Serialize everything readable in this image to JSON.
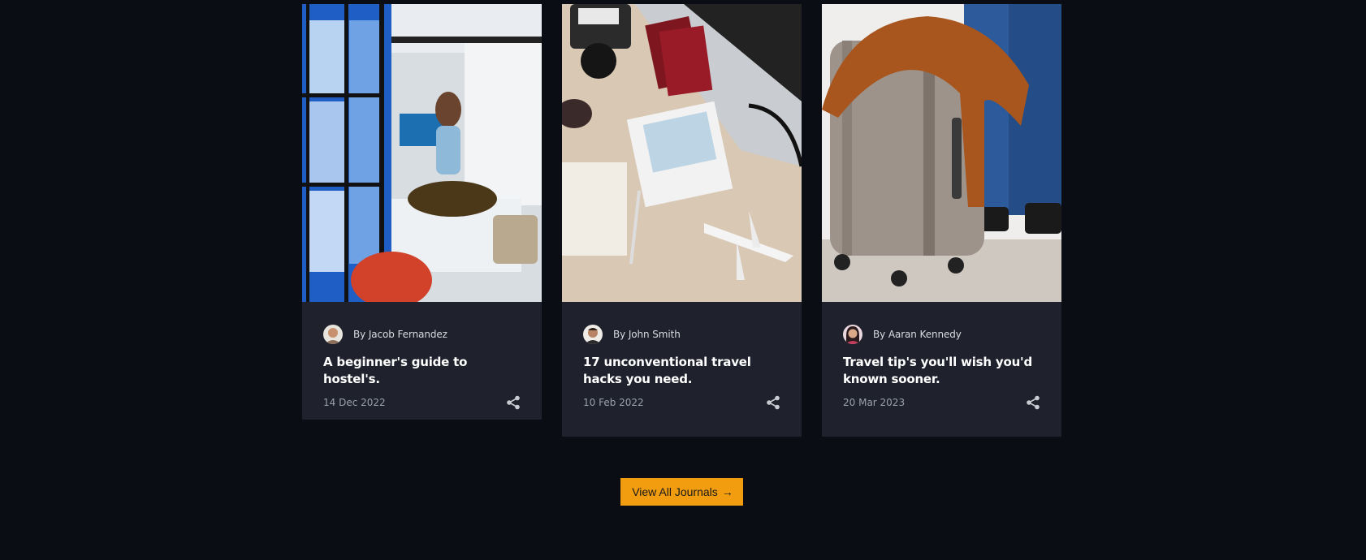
{
  "journals": [
    {
      "author": "By Jacob Fernandez",
      "title": "A beginner's guide to hostel's.",
      "date": "14 Dec 2022"
    },
    {
      "author": "By John Smith",
      "title": "17 unconventional travel hacks you need.",
      "date": "10 Feb 2022"
    },
    {
      "author": "By Aaran Kennedy",
      "title": "Travel tip's you'll wish you'd known sooner.",
      "date": "20 Mar 2023"
    }
  ],
  "view_all": {
    "label": "View All Journals",
    "arrow": "→"
  },
  "colors": {
    "page_bg": "#0a0d14",
    "card_bg": "#1f222c",
    "accent": "#f29d0f"
  }
}
